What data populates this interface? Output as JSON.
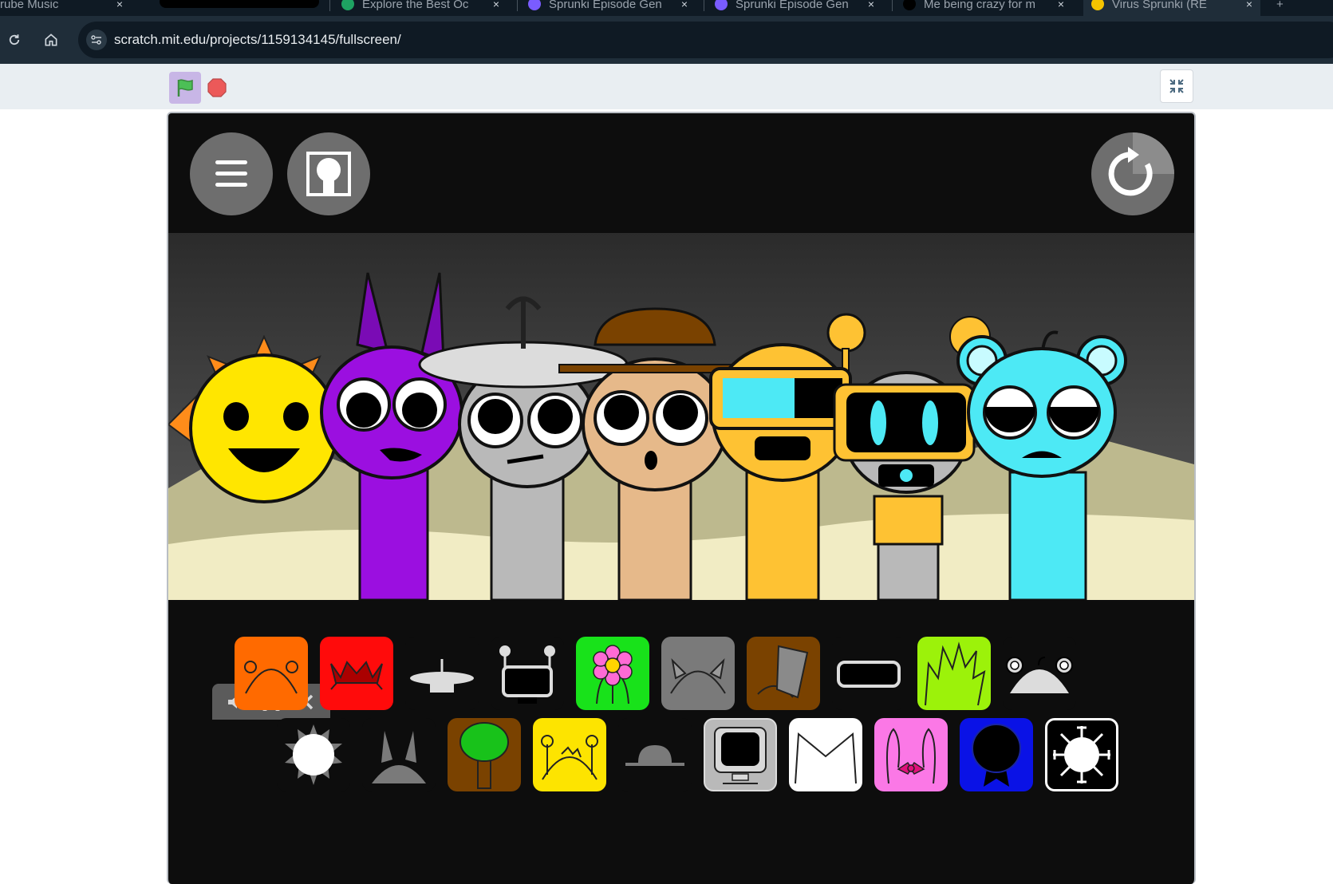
{
  "browser": {
    "tabs": [
      {
        "label": "rube Music",
        "close": "×"
      },
      {
        "label": "Explore the Best Oc",
        "close": "×",
        "icon_color": "#1ea362"
      },
      {
        "label": "Sprunki Episode Gen",
        "close": "×",
        "icon_color": "#7a5cff"
      },
      {
        "label": "Sprunki Episode Gen",
        "close": "×",
        "icon_color": "#7a5cff"
      },
      {
        "label": "Me being crazy for m",
        "close": "×",
        "icon_color": "#000000"
      },
      {
        "label": "Virus Sprunki (RE",
        "close": "×",
        "icon_color": "#f5c400"
      }
    ],
    "new_tab": "+",
    "url": "scratch.mit.edu/projects/1159134145/fullscreen/"
  },
  "scratch": {
    "flag_color": "#4cbf56",
    "stop_color": "#ec5959"
  },
  "stage": {
    "background": "#0d0d0d",
    "scene_sky_top": "#2b2b2b",
    "scene_sky_bottom": "#5e5e5e",
    "ground": "#f1ecc4",
    "characters": [
      {
        "name": "sun",
        "color": "#ffe600"
      },
      {
        "name": "purple-horned",
        "color": "#9b0fe0"
      },
      {
        "name": "gray-saucer",
        "color": "#b9b9b9"
      },
      {
        "name": "tan-hat",
        "color": "#e6b98a"
      },
      {
        "name": "yellow-goggles",
        "color": "#fec233"
      },
      {
        "name": "gray-robot",
        "color": "#b9b9b9"
      },
      {
        "name": "cyan-bear",
        "color": "#4de9f5"
      }
    ],
    "icon_row_1": [
      {
        "name": "orange-antennae-tile",
        "bg": "#ff6a00"
      },
      {
        "name": "red-spiky-tile",
        "bg": "#ff0b0b"
      },
      {
        "name": "saucer-hat-tile",
        "bg": "#0d0d0d"
      },
      {
        "name": "robot-tile",
        "bg": "#0d0d0d"
      },
      {
        "name": "flower-tile",
        "bg": "#18e21a"
      },
      {
        "name": "gray-ears-tile",
        "bg": "#7a7a7a"
      },
      {
        "name": "bucket-tile",
        "bg": "#7a4200"
      },
      {
        "name": "goggles-tile",
        "bg": "#0d0d0d"
      },
      {
        "name": "lime-spikes-tile",
        "bg": "#9cf20a"
      },
      {
        "name": "bear-ears-tile",
        "bg": "#0d0d0d"
      }
    ],
    "icon_row_2": [
      {
        "name": "sun-tile",
        "bg": "#0d0d0d"
      },
      {
        "name": "horns-tile",
        "bg": "#0d0d0d"
      },
      {
        "name": "tree-tile",
        "bg": "#7a4200"
      },
      {
        "name": "yellow-antennae-tile",
        "bg": "#fde400"
      },
      {
        "name": "bowler-hat-tile",
        "bg": "#0d0d0d"
      },
      {
        "name": "monitor-tile",
        "bg": "#b9b9b9"
      },
      {
        "name": "envelope-tile",
        "bg": "#ffffff"
      },
      {
        "name": "bunny-bow-tile",
        "bg": "#fb78e6"
      },
      {
        "name": "blue-dark-tile",
        "bg": "#0a12e6"
      },
      {
        "name": "virus-tile",
        "bg": "#000000"
      }
    ]
  }
}
